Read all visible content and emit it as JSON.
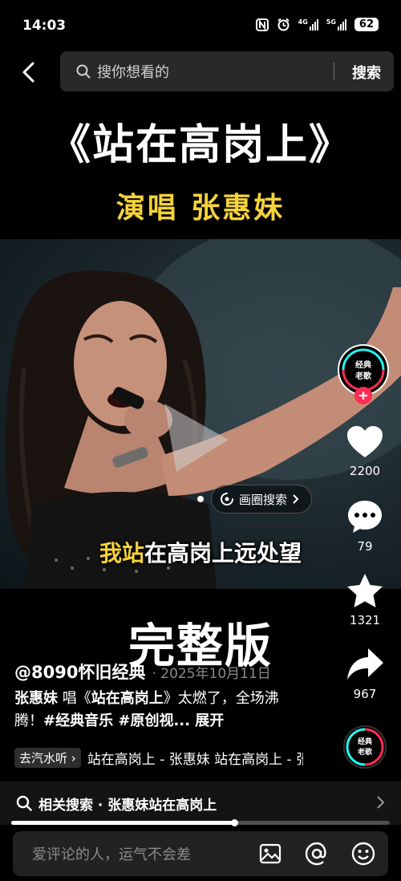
{
  "status_bar": {
    "time": "14:03",
    "net1": "4G",
    "net2": "5G",
    "battery": "62"
  },
  "search": {
    "placeholder": "搜你想看的",
    "submit_label": "搜索"
  },
  "video": {
    "title": "《站在高岗上》",
    "subtitle": "演唱  张惠妹",
    "lyric_highlight": "我站",
    "lyric_rest": "在高岗上远处望",
    "circle_search_label": "画圈搜索",
    "overlay_text": "完整版"
  },
  "actions": {
    "likes": "2200",
    "comments": "79",
    "favorites": "1321",
    "shares": "967",
    "avatar_text_1": "经典",
    "avatar_text_2": "老歌"
  },
  "post": {
    "author": "@8090怀旧经典",
    "date": "· 2025年10月11日",
    "caption_singer": "张惠妹",
    "caption_mid1": " 唱《",
    "caption_song": "站在高岗上",
    "caption_mid2": "》太燃了，全场沸腾！",
    "caption_tag1": "#经典音乐",
    "caption_tag2": " #原创视...",
    "caption_expand": " 展开",
    "music_source": "去汽水听",
    "music_name": "站在高岗上 - 张惠妹   站在高岗上 - 张惠妹"
  },
  "related": {
    "text": "相关搜索 · 张惠妹站在高岗上"
  },
  "playback": {
    "progress": 0.59
  },
  "comment": {
    "placeholder": "爱评论的人，运气不会差"
  },
  "colors": {
    "accent_yellow": "#f5d33a",
    "plus_red": "#fe2c55",
    "ring_cyan": "#25f4ee",
    "ring_red": "#fe2c55"
  }
}
